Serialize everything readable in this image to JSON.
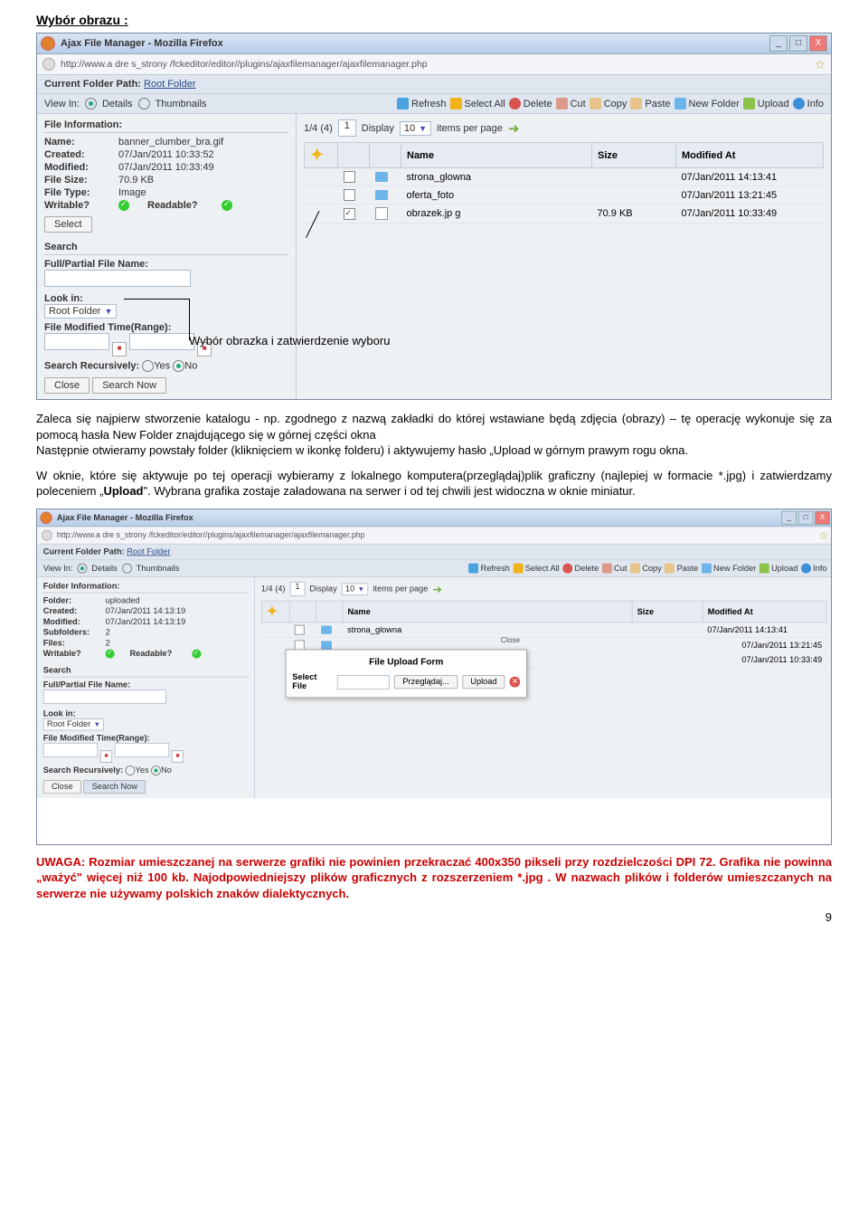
{
  "heading": "Wybór obrazu :",
  "annot1": "Wybór obrazka i zatwierdzenie wyboru",
  "firefox": {
    "title": "Ajax File Manager - Mozilla Firefox",
    "url": "http://www.a dre s_strony /fckeditor/editor//plugins/ajaxfilemanager/ajaxfilemanager.php",
    "min": "_",
    "max": "□",
    "close": "X"
  },
  "pathbar": {
    "label": "Current Folder Path:",
    "root": "Root Folder"
  },
  "viewin": {
    "label": "View In:",
    "details": "Details",
    "thumbs": "Thumbnails"
  },
  "toolbar": {
    "refresh": "Refresh",
    "selectall": "Select All",
    "delete": "Delete",
    "cut": "Cut",
    "copy": "Copy",
    "paste": "Paste",
    "newfolder": "New Folder",
    "upload": "Upload",
    "info": "Info"
  },
  "fileinfo": {
    "title": "File Information:",
    "name": {
      "k": "Name:",
      "v": "banner_clumber_bra.gif"
    },
    "created": {
      "k": "Created:",
      "v": "07/Jan/2011 10:33:52"
    },
    "modified": {
      "k": "Modified:",
      "v": "07/Jan/2011 10:33:49"
    },
    "size": {
      "k": "File Size:",
      "v": "70.9 KB"
    },
    "type": {
      "k": "File Type:",
      "v": "Image"
    },
    "writable": {
      "k": "Writable?"
    },
    "readable": {
      "k": "Readable?"
    },
    "select": "Select"
  },
  "folderinfo": {
    "title": "Folder Information:",
    "folder": {
      "k": "Folder:",
      "v": "uploaded"
    },
    "created": {
      "k": "Created:",
      "v": "07/Jan/2011 14:13:19"
    },
    "modified": {
      "k": "Modified:",
      "v": "07/Jan/2011 14:13:19"
    },
    "subfolders": {
      "k": "Subfolders:",
      "v": "2"
    },
    "files": {
      "k": "Files:",
      "v": "2"
    },
    "writable": {
      "k": "Writable?"
    },
    "readable": {
      "k": "Readable?"
    }
  },
  "pager": {
    "count": "1/4 (4)",
    "page": "1",
    "display": "Display",
    "ipp": "items per page",
    "sel": "10"
  },
  "cols": {
    "name": "Name",
    "size": "Size",
    "mod": "Modified At"
  },
  "rows": [
    {
      "name": "strona_glowna",
      "size": "",
      "mod": "07/Jan/2011 14:13:41",
      "type": "folder"
    },
    {
      "name": "oferta_foto",
      "size": "",
      "mod": "07/Jan/2011 13:21:45",
      "type": "folder"
    },
    {
      "name": "obrazek.jp g",
      "size": "70.9 KB",
      "mod": "07/Jan/2011 10:33:49",
      "type": "image"
    }
  ],
  "search": {
    "title": "Search",
    "fullpartial": "Full/Partial File Name:",
    "lookin": "Look in:",
    "rootfolder": "Root Folder",
    "fmt": "File Modified Time(Range):",
    "recursive": "Search Recursively:",
    "yes": "Yes",
    "no": "No",
    "close": "Close",
    "searchnow": "Search Now"
  },
  "uploaddlg": {
    "title": "File Upload Form",
    "selectfile": "Select File",
    "browse": "Przeglądaj...",
    "upload": "Upload",
    "close": "Close"
  },
  "para1a": "Zaleca się najpierw stworzenie katalogu  - np. zgodnego z nazwą zakładki do której wstawiane będą zdjęcia (obrazy) – tę operację wykonuje się za pomocą hasła New Folder znajdującego się w górnej części okna",
  "para1b": "Następnie otwieramy powstały folder (kliknięciem w ikonkę folderu) i aktywujemy hasło „Upload w górnym prawym rogu okna.",
  "para2a": "W oknie, które się aktywuje po tej operacji  wybieramy z  lokalnego komputera(przeglądaj)plik graficzny (najlepiej w formacie *.jpg)  i zatwierdzamy poleceniem „",
  "para2b": "Upload",
  "para2c": "\". Wybrana grafika zostaje załadowana na serwer i od tej chwili jest widoczna w oknie miniatur.",
  "notice1": "UWAGA: Rozmiar  umieszczanej na serwerze grafiki nie powinien przekraczać 400x350 pikseli przy rozdzielczości DPI 72. Grafika nie powinna „ważyć\" więcej niż 100 kb. Najodpowiedniejszy plików graficznych z rozszerzeniem *.jpg",
  "notice1b": " . W nazwach plików i folderów umieszczanych na serwerze nie używamy polskich znaków  dialektycznych.",
  "pgnum": "9"
}
